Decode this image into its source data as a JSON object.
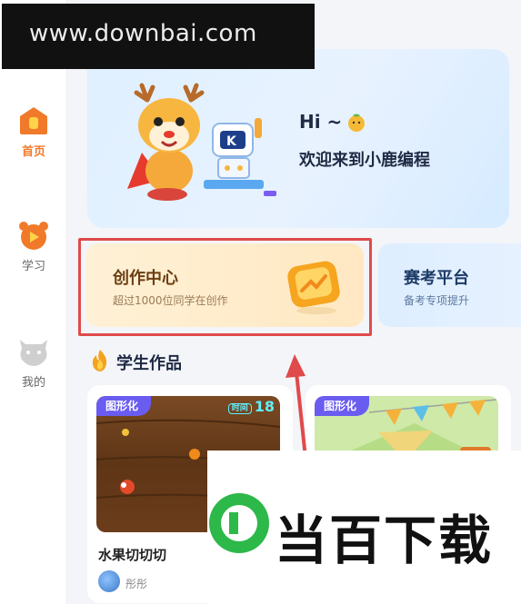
{
  "watermark_top": "www.downbai.com",
  "watermark_bottom": "当百下载",
  "sidebar": {
    "items": [
      {
        "label": "首页",
        "icon": "home-icon",
        "active": true
      },
      {
        "label": "学习",
        "icon": "learn-icon",
        "active": false
      },
      {
        "label": "我的",
        "icon": "profile-icon",
        "active": false
      }
    ]
  },
  "banner": {
    "greeting": "Hi ~",
    "welcome": "欢迎来到小鹿编程"
  },
  "cards": {
    "create": {
      "title": "创作中心",
      "subtitle": "超过1000位同学在创作"
    },
    "exam": {
      "title": "赛考平台",
      "subtitle": "备考专项提升"
    }
  },
  "section": {
    "title": "学生作品"
  },
  "works": [
    {
      "tag": "图形化",
      "name": "水果切切切",
      "author": "彤彤",
      "timer_label": "时间",
      "timer_value": "18"
    },
    {
      "tag": "图形化",
      "name": "",
      "author": ""
    }
  ],
  "colors": {
    "accent": "#f07a2a",
    "highlight_border": "#e04a4a",
    "tag_bg": "#6a5cf0"
  }
}
